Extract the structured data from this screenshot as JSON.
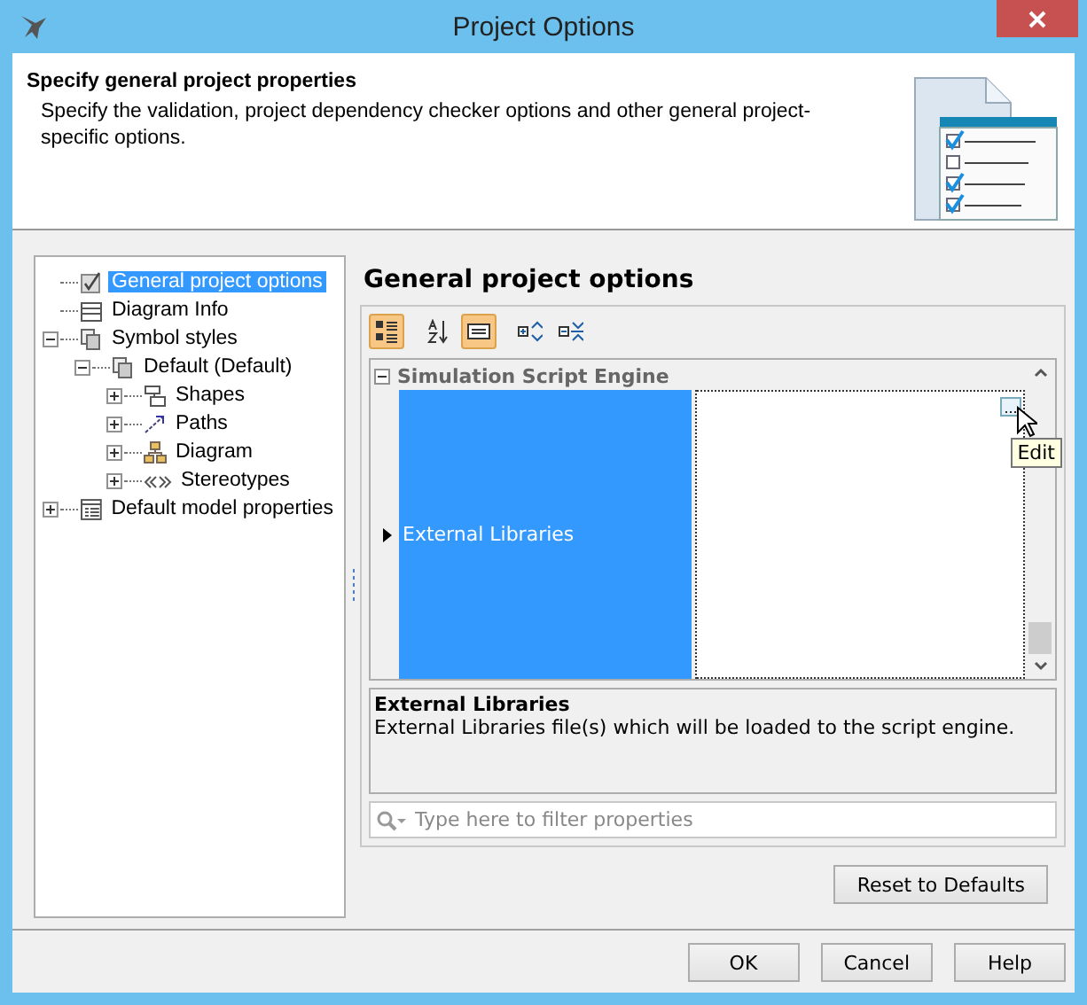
{
  "window": {
    "title": "Project Options"
  },
  "header": {
    "title": "Specify general project properties",
    "description": "Specify the validation, project dependency checker options and other general project-specific options."
  },
  "tree": [
    {
      "label": "General project options",
      "kind": "check",
      "selected": true
    },
    {
      "label": "Diagram Info",
      "kind": "table",
      "selected": false
    },
    {
      "label": "Symbol styles",
      "kind": "styles",
      "selected": false,
      "expanded": true,
      "children": [
        {
          "label": "Default (Default)",
          "kind": "styles",
          "selected": false,
          "expanded": true,
          "children": [
            {
              "label": "Shapes",
              "kind": "shapes",
              "selected": false,
              "expanded": false
            },
            {
              "label": "Paths",
              "kind": "paths",
              "selected": false,
              "expanded": false
            },
            {
              "label": "Diagram",
              "kind": "diagram",
              "selected": false,
              "expanded": false
            },
            {
              "label": "Stereotypes",
              "kind": "stereo",
              "selected": false,
              "expanded": false
            }
          ]
        }
      ]
    },
    {
      "label": "Default model properties",
      "kind": "props",
      "selected": false,
      "expanded": false
    }
  ],
  "panel": {
    "title": "General project options",
    "toolbar": [
      {
        "kind": "categorized",
        "selected": true
      },
      {
        "kind": "sort",
        "selected": false
      },
      {
        "kind": "description",
        "selected": true
      },
      {
        "kind": "expand",
        "selected": false
      },
      {
        "kind": "collapse",
        "selected": false
      }
    ],
    "category": {
      "label": "Simulation Script Engine",
      "expanded": true
    },
    "rows": [
      {
        "name": "External Libraries",
        "selected": true,
        "edit_button": "..."
      }
    ],
    "tooltip": "Edit",
    "description": {
      "title": "External Libraries",
      "text": "External Libraries file(s) which will be loaded to the script engine."
    },
    "filter": {
      "placeholder": "Type here to filter properties"
    }
  },
  "reset_button": "Reset to Defaults",
  "buttons": [
    "OK",
    "Cancel",
    "Help"
  ]
}
